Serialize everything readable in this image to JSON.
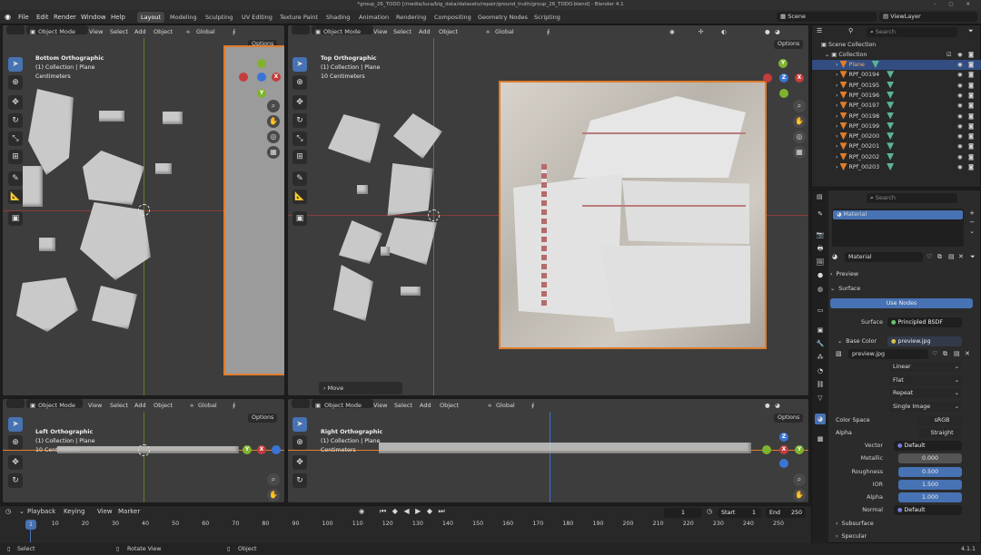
{
  "window": {
    "title": "*group_26_TODO [/media/luca/big_data/datasets/repair/ground_truth/group_26_TODO.blend] - Blender 4.1",
    "controls": "–  ▢  ✕"
  },
  "menu": [
    "File",
    "Edit",
    "Render",
    "Window",
    "Help"
  ],
  "workspaces": [
    "Layout",
    "Modeling",
    "Sculpting",
    "UV Editing",
    "Texture Paint",
    "Shading",
    "Animation",
    "Rendering",
    "Compositing",
    "Geometry Nodes",
    "Scripting"
  ],
  "scene": "Scene",
  "view_layer": "ViewLayer",
  "viewports": [
    {
      "mode": "Object Mode",
      "menus": [
        "View",
        "Select",
        "Add",
        "Object"
      ],
      "transform": "Global",
      "title": "Bottom Orthographic",
      "collection": "(1) Collection | Plane",
      "scale": "Centimeters",
      "options": "Options"
    },
    {
      "mode": "Object Mode",
      "menus": [
        "View",
        "Select",
        "Add",
        "Object"
      ],
      "transform": "Global",
      "title": "Top Orthographic",
      "collection": "(1) Collection | Plane",
      "scale": "10 Centimeters",
      "options": "Options"
    },
    {
      "mode": "Object Mode",
      "menus": [
        "View",
        "Select",
        "Add",
        "Object"
      ],
      "transform": "Global",
      "title": "Left Orthographic",
      "collection": "(1) Collection | Plane",
      "scale": "10 Centimeters",
      "options": "Options"
    },
    {
      "mode": "Object Mode",
      "menus": [
        "View",
        "Select",
        "Add",
        "Object"
      ],
      "transform": "Global",
      "title": "Right Orthographic",
      "collection": "(1) Collection | Plane",
      "scale": "Centimeters",
      "options": "Options"
    }
  ],
  "operator_panel": "Move",
  "outliner": {
    "search_placeholder": "Search",
    "scene_collection": "Scene Collection",
    "collection": "Collection",
    "items": [
      "Plane",
      "RPf_00194",
      "RPf_00195",
      "RPf_00196",
      "RPf_00197",
      "RPf_00198",
      "RPf_00199",
      "RPf_00200",
      "RPf_00201",
      "RPf_00202",
      "RPf_00203"
    ]
  },
  "properties": {
    "search_placeholder": "Search",
    "slot": "Material",
    "material": "Material",
    "preview": "Preview",
    "surface": "Surface",
    "use_nodes": "Use Nodes",
    "surface_label": "Surface",
    "surface_value": "Principled BSDF",
    "base_color_label": "Base Color",
    "base_color_value": "preview.jpg",
    "image": "preview.jpg",
    "interp": "Linear",
    "proj": "Flat",
    "ext": "Repeat",
    "source": "Single Image",
    "colorspace_label": "Color Space",
    "colorspace": "sRGB",
    "alpha_label": "Alpha",
    "alpha_mode": "Straight",
    "vector_label": "Vector",
    "vector": "Default",
    "metallic_label": "Metallic",
    "metallic": "0.000",
    "roughness_label": "Roughness",
    "roughness": "0.500",
    "ior_label": "IOR",
    "ior": "1.500",
    "alpha2_label": "Alpha",
    "alpha2": "1.000",
    "normal_label": "Normal",
    "normal": "Default",
    "subsurface": "Subsurface",
    "specular": "Specular"
  },
  "timeline": {
    "menus": [
      "Playback",
      "Keying",
      "View",
      "Marker"
    ],
    "current": "1",
    "start_label": "Start",
    "start": "1",
    "end_label": "End",
    "end": "250",
    "ticks": [
      "1",
      "10",
      "20",
      "30",
      "40",
      "50",
      "60",
      "70",
      "80",
      "90",
      "100",
      "110",
      "120",
      "130",
      "140",
      "150",
      "160",
      "170",
      "180",
      "190",
      "200",
      "210",
      "220",
      "230",
      "240",
      "250"
    ]
  },
  "status": {
    "select": "Select",
    "rotate": "Rotate View",
    "object": "Object",
    "version": "4.1.1"
  },
  "colors": {
    "accent": "#4772b3",
    "selected": "#e07d2b",
    "x_axis": "#c43c3c",
    "y_axis": "#7fb32d",
    "z_axis": "#3b74d6"
  }
}
